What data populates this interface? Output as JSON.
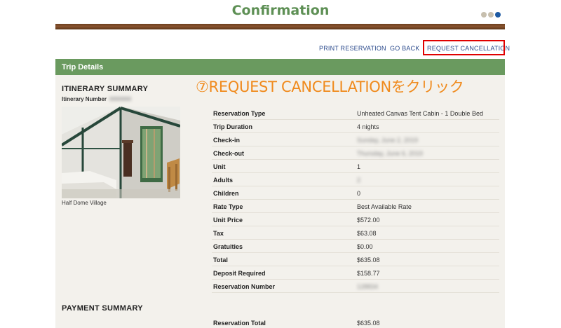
{
  "header": {
    "title": "Confirmation",
    "progress_dots": [
      {
        "state": "done"
      },
      {
        "state": "done"
      },
      {
        "state": "active"
      }
    ]
  },
  "actions": {
    "print": "PRINT RESERVATION",
    "back": "GO BACK",
    "cancel": "REQUEST CANCELLATION"
  },
  "annotation": "⑦REQUEST CANCELLATIONをクリック",
  "trip": {
    "header": "Trip Details",
    "itinerary_title": "ITINERARY SUMMARY",
    "itinerary_label": "Itinerary Number",
    "itinerary_value": "0000000",
    "photo_caption": "Half Dome Village",
    "rows": [
      {
        "label": "Reservation Type",
        "value": "Unheated Canvas Tent Cabin - 1 Double Bed"
      },
      {
        "label": "Trip Duration",
        "value": "4 nights"
      },
      {
        "label": "Check-in",
        "value": "Sunday, June 2, 2019",
        "blurred": true
      },
      {
        "label": "Check-out",
        "value": "Thursday, June 6, 2019",
        "blurred": true
      },
      {
        "label": "Unit",
        "value": "1"
      },
      {
        "label": "Adults",
        "value": "2",
        "blurred": true
      },
      {
        "label": "Children",
        "value": "0"
      },
      {
        "label": "Rate Type",
        "value": "Best Available Rate"
      },
      {
        "label": "Unit Price",
        "value": "$572.00"
      },
      {
        "label": "Tax",
        "value": "$63.08"
      },
      {
        "label": "Gratuities",
        "value": "$0.00"
      },
      {
        "label": "Total",
        "value": "$635.08"
      },
      {
        "label": "Deposit Required",
        "value": "$158.77"
      },
      {
        "label": "Reservation Number",
        "value": "128834",
        "blurred": true
      }
    ]
  },
  "payment": {
    "title": "PAYMENT SUMMARY",
    "total_label": "Reservation Total",
    "total_value": "$635.08"
  },
  "colors": {
    "title_green": "#5d8f54",
    "header_green": "#6a9a5f",
    "link_blue": "#2b4a8c",
    "annotation_orange": "#f08a1c",
    "highlight_red": "#e00000"
  }
}
